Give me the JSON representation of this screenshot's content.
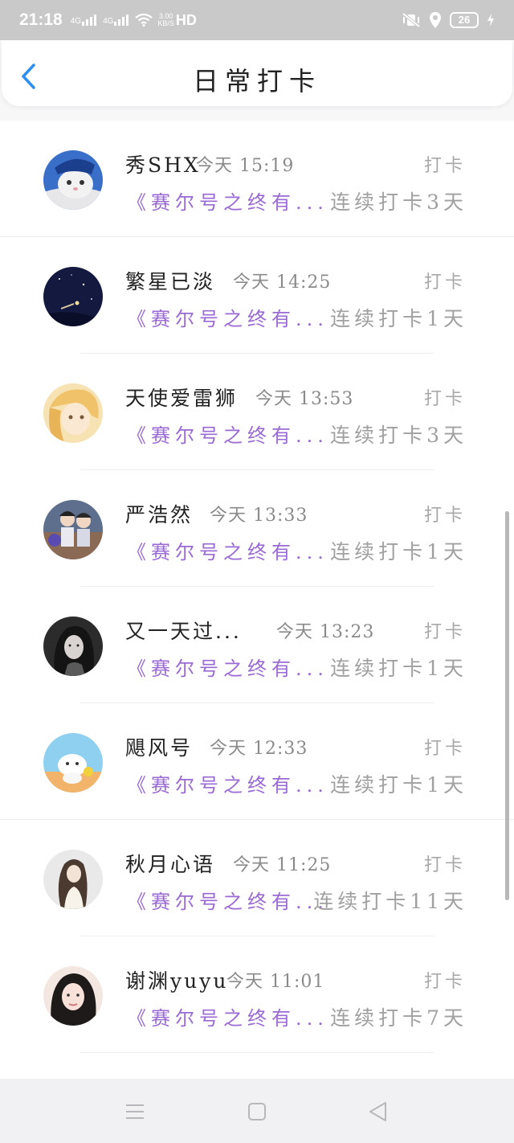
{
  "status_bar": {
    "time": "21:18",
    "sim1": "4G",
    "sim2": "4G",
    "speed_value": "3.00",
    "speed_unit": "KB/S",
    "hd": "HD",
    "battery": "26"
  },
  "header": {
    "title": "日常打卡",
    "back_icon": "chevron-left-icon",
    "accent": "#2d8ff0"
  },
  "colors": {
    "book_purple": "#9a6ad4",
    "muted_gray": "#a0a0a0"
  },
  "entries": [
    {
      "name": "秀SHX",
      "time": "今天 15:19",
      "action": "打卡",
      "book": "《赛尔号之终有...",
      "streak": "连续打卡3天"
    },
    {
      "name": "繁星已淡",
      "time": "今天 14:25",
      "action": "打卡",
      "book": "《赛尔号之终有...",
      "streak": "连续打卡1天"
    },
    {
      "name": "天使爱雷狮",
      "time": "今天 13:53",
      "action": "打卡",
      "book": "《赛尔号之终有...",
      "streak": "连续打卡3天"
    },
    {
      "name": "严浩然",
      "time": "今天 13:33",
      "action": "打卡",
      "book": "《赛尔号之终有...",
      "streak": "连续打卡1天"
    },
    {
      "name": "又一天过...",
      "time": "今天 13:23",
      "action": "打卡",
      "book": "《赛尔号之终有...",
      "streak": "连续打卡1天"
    },
    {
      "name": "飓风号",
      "time": "今天 12:33",
      "action": "打卡",
      "book": "《赛尔号之终有...",
      "streak": "连续打卡1天"
    },
    {
      "name": "秋月心语",
      "time": "今天 11:25",
      "action": "打卡",
      "book": "《赛尔号之终有...",
      "streak": "连续打卡11天"
    },
    {
      "name": "谢渊yuyu",
      "time": "今天 11:01",
      "action": "打卡",
      "book": "《赛尔号之终有...",
      "streak": "连续打卡7天"
    }
  ],
  "nav_bar": {
    "menu_icon": "menu-icon",
    "home_icon": "square-home-icon",
    "back_icon": "triangle-back-icon"
  }
}
